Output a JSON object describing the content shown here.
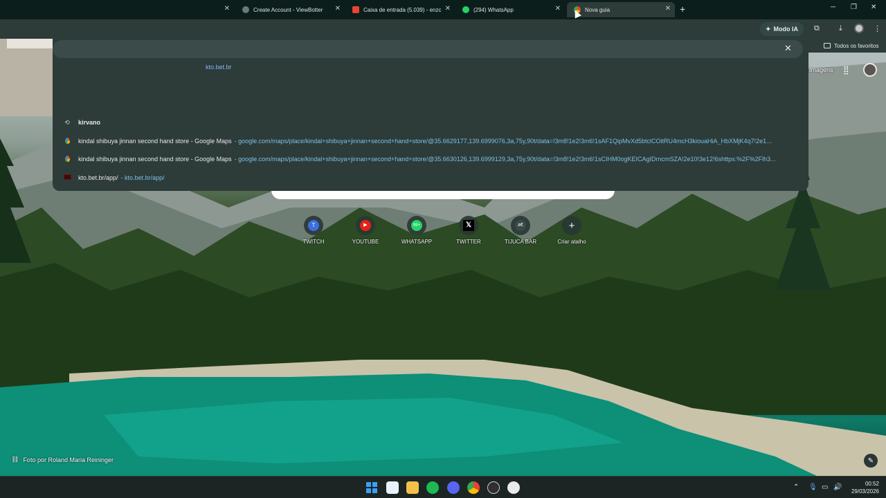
{
  "tabs": [
    {
      "title": "",
      "favicon": "blank-favicon"
    },
    {
      "title": "Create Account - ViewBotter",
      "favicon": "globe-favicon"
    },
    {
      "title": "Caixa de entrada (5.039) - enzo",
      "favicon": "gmail-favicon"
    },
    {
      "title": "(294) WhatsApp",
      "favicon": "whatsapp-favicon"
    },
    {
      "title": "Nova guia",
      "favicon": "chrome-favicon",
      "active": true
    }
  ],
  "toolbar": {
    "modo_ia_label": "Modo IA",
    "bookmarks_label": "Todos os favoritos"
  },
  "omnibox": {
    "typed_text": "kto.bet.br",
    "typed_highlight": "kto.bet.br",
    "suggestions": [
      {
        "icon": "history-icon",
        "text": "kirvano",
        "url": ""
      },
      {
        "icon": "maps-pin-icon",
        "text": "kindal shibuya jinnan second hand store - Google Maps",
        "url": "- google.com/maps/place/kindal+shibuya+jinnan+second+hand+store/@35.6629177,139.6999076,3a,75y,90t/data=!3m8!1e2!3m6!1sAF1QipMvXd5btclCOitRU4mcH3kiouaHiA_HbXMjK4q7!2e1..."
      },
      {
        "icon": "maps-pin-icon",
        "text": "kindal shibuya jinnan second hand store - Google Maps",
        "url": "- google.com/maps/place/kindal+shibuya+jinnan+second+hand+store/@35.6630126,139.6999129,3a,75y,90t/data=!3m8!1e2!3m6!1sCIHM0ogKEICAgIDrncmSZA!2e10!3e12!6shttps:%2F%2Flh3..."
      },
      {
        "icon": "kto-favicon",
        "text": "kto.bet.br/app/",
        "url": "- kto.bet.br/app/"
      }
    ]
  },
  "newtab": {
    "images_link": "Imagens",
    "shortcuts": [
      {
        "label": "TWITCH",
        "icon": "twitch-letter-icon"
      },
      {
        "label": "YOUTUBE",
        "icon": "youtube-icon"
      },
      {
        "label": "WHATSAPP",
        "icon": "whatsapp-badge-icon"
      },
      {
        "label": "TWITTER",
        "icon": "x-icon"
      },
      {
        "label": "TIJUCA BAR",
        "icon": "tijuca-icon"
      },
      {
        "label": "Criar atalho",
        "icon": "plus-icon"
      }
    ],
    "photo_credit": "Foto por Roland Maria Reininger"
  },
  "taskbar": {
    "time": "00:52",
    "date": "29/03/2026",
    "apps": [
      "windows-start-icon",
      "widgets-icon",
      "file-explorer-icon",
      "spotify-icon",
      "discord-icon",
      "chrome-icon",
      "obs-icon",
      "chatgpt-icon"
    ]
  }
}
